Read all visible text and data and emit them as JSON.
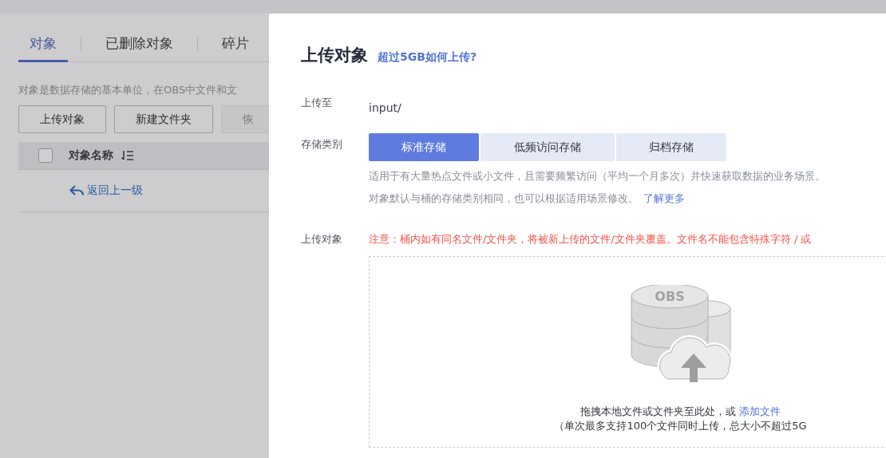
{
  "background_page": {
    "tabs": [
      {
        "label": "对象",
        "selected": true
      },
      {
        "label": "已删除对象",
        "selected": false
      },
      {
        "label": "碎片",
        "selected": false
      }
    ],
    "description": "对象是数据存储的基本单位，在OBS中文件和文",
    "buttons": [
      {
        "label": "上传对象",
        "disabled": false
      },
      {
        "label": "新建文件夹",
        "disabled": false
      },
      {
        "label": "恢",
        "disabled": true
      }
    ],
    "table": {
      "select_all_checked": false,
      "columns": [
        {
          "label": "对象名称"
        }
      ],
      "back_link": "返回上一级"
    }
  },
  "dialog": {
    "title": "上传对象",
    "help_link": "超过5GB如何上传?",
    "fields": [
      {
        "kind": "text",
        "label": "上传至",
        "value": "input/"
      },
      {
        "kind": "segmented",
        "label": "存储类别",
        "options": [
          {
            "label": "标准存储",
            "selected": true
          },
          {
            "label": "低频访问存储",
            "selected": false
          },
          {
            "label": "归档存储",
            "selected": false
          }
        ],
        "notes": [
          {
            "text": "适用于有大量热点文件或小文件，且需要频繁访问（平均一个月多次）并快速获取数据的业务场景。"
          },
          {
            "text": "对象默认与桶的存储类别相同，也可以根据适用场景修改。",
            "link": "了解更多"
          }
        ]
      },
      {
        "kind": "upload",
        "label": "上传对象",
        "warning": "注意：桶内如有同名文件/文件夹，将被新上传的文件/文件夹覆盖。文件名不能包含特殊字符 / 或",
        "icon_label": "OBS",
        "drop_text": "拖拽本地文件或文件夹至此处，或",
        "drop_link": "添加文件",
        "limit_note": "（单次最多支持100个文件同时上传，总大小不超过5G"
      }
    ]
  }
}
